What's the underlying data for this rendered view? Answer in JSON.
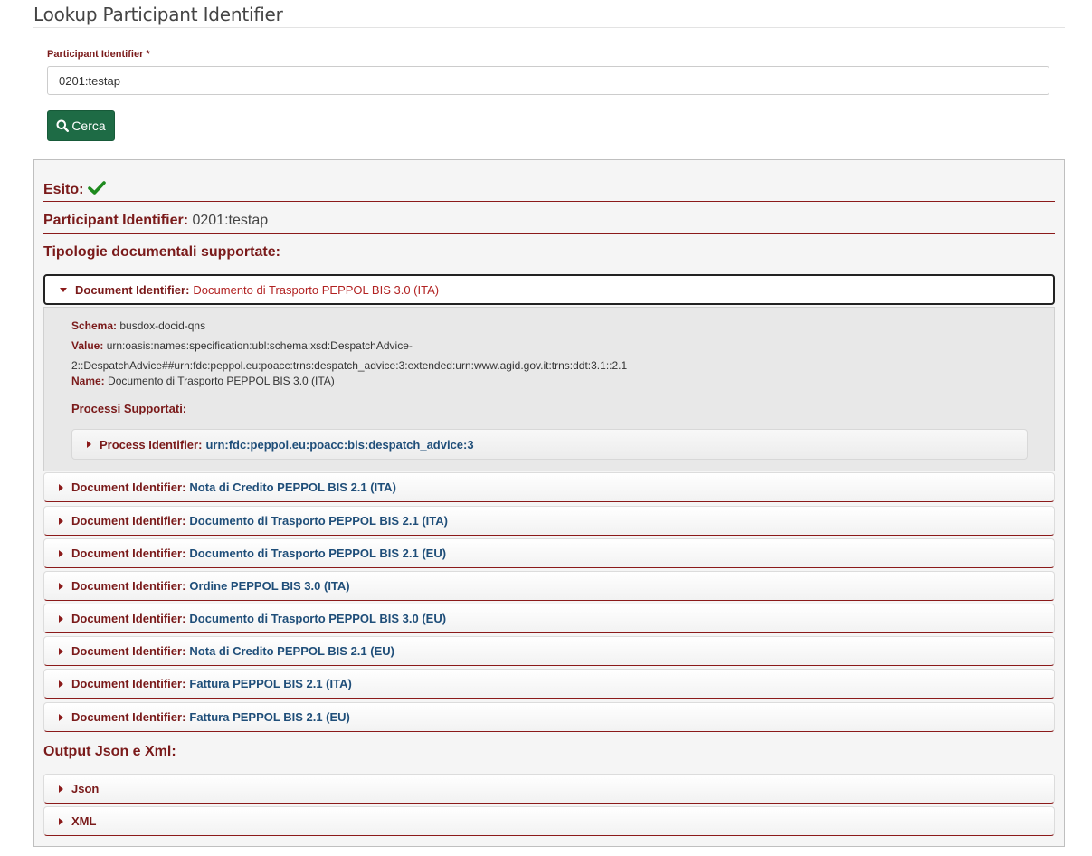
{
  "page": {
    "title": "Lookup Participant Identifier"
  },
  "form": {
    "label": "Participant Identifier",
    "required_mark": "*",
    "input_value": "0201:testap",
    "search_label": "Cerca"
  },
  "result": {
    "esito_label": "Esito:",
    "participant_label": "Participant Identifier:",
    "participant_value": "0201:testap",
    "doc_types_heading": "Tipologie documentali supportate:",
    "doc_label": "Document Identifier:",
    "open_doc": {
      "name": "Documento di Trasporto PEPPOL BIS 3.0 (ITA)",
      "schema_label": "Schema:",
      "schema_value": "busdox-docid-qns",
      "value_label": "Value:",
      "value_line1": "urn:oasis:names:specification:ubl:schema:xsd:DespatchAdvice-",
      "value_line2": "2::DespatchAdvice##urn:fdc:peppol.eu:poacc:trns:despatch_advice:3:extended:urn:www.agid.gov.it:trns:ddt:3.1::2.1",
      "name_label": "Name:",
      "name_value": "Documento di Trasporto PEPPOL BIS 3.0 (ITA)",
      "processes_heading": "Processi Supportati:",
      "process_label": "Process Identifier:",
      "process_value": "urn:fdc:peppol.eu:poacc:bis:despatch_advice:3"
    },
    "docs": [
      "Nota di Credito PEPPOL BIS 2.1 (ITA)",
      "Documento di Trasporto PEPPOL BIS 2.1 (ITA)",
      "Documento di Trasporto PEPPOL BIS 2.1 (EU)",
      "Ordine PEPPOL BIS 3.0 (ITA)",
      "Documento di Trasporto PEPPOL BIS 3.0 (EU)",
      "Nota di Credito PEPPOL BIS 2.1 (EU)",
      "Fattura PEPPOL BIS 2.1 (ITA)",
      "Fattura PEPPOL BIS 2.1 (EU)"
    ],
    "output_heading": "Output Json e Xml:",
    "outputs": [
      "Json",
      "XML"
    ]
  },
  "colors": {
    "accent": "#7a1a1a",
    "button": "#1e6b45",
    "success": "#1e8a1e",
    "link_value": "#1f4e79"
  },
  "icons": {
    "search": "search-icon",
    "success": "check-icon",
    "expand": "caret-right-icon",
    "collapse": "caret-down-icon"
  }
}
